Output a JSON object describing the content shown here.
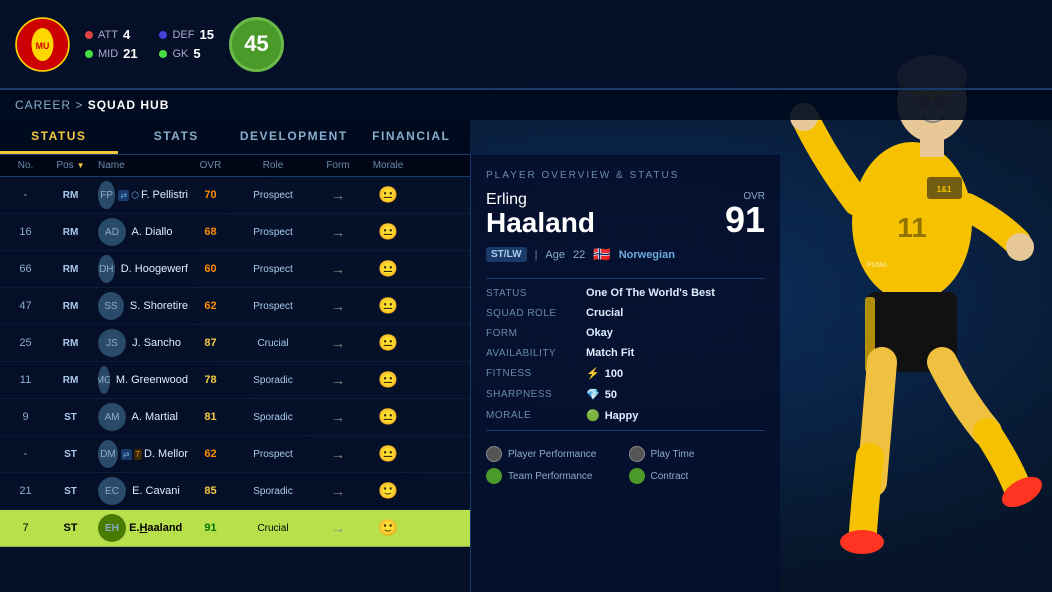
{
  "club": {
    "name": "Manchester United",
    "stats": {
      "att": {
        "label": "ATT",
        "value": "4",
        "color": "#dd4444"
      },
      "def": {
        "label": "DEF",
        "value": "15",
        "color": "#4444dd"
      },
      "mid": {
        "label": "MID",
        "value": "21",
        "color": "#44dd44"
      },
      "gk": {
        "label": "GK",
        "value": "5",
        "color": "#44dd44"
      },
      "overall": "45"
    }
  },
  "breadcrumb": {
    "parent": "CAREER",
    "current": "SQUAD HUB"
  },
  "nav": {
    "tabs": [
      "STATUS",
      "STATS",
      "DEVELOPMENT",
      "FINANCIAL"
    ],
    "active": "STATUS"
  },
  "table": {
    "headers": [
      "No.",
      "Pos ▼",
      "Name",
      "OVR",
      "Role",
      "Form",
      "Morale"
    ],
    "rows": [
      {
        "no": "-",
        "pos": "RM",
        "name": "F. Pellistri",
        "bold_part": "F.",
        "ovr": "70",
        "ovr_class": "ovr-orange",
        "role": "Prospect",
        "form": "→",
        "morale": "😐",
        "morale_class": "morale-neutral",
        "icons": [
          "transfer"
        ],
        "selected": false
      },
      {
        "no": "16",
        "pos": "RM",
        "name": "A. Diallo",
        "bold_part": "A.",
        "ovr": "68",
        "ovr_class": "ovr-orange",
        "role": "Prospect",
        "form": "→",
        "morale": "😐",
        "morale_class": "morale-neutral",
        "icons": [],
        "selected": false
      },
      {
        "no": "66",
        "pos": "RM",
        "name": "D. Hoogewerf",
        "bold_part": "D.",
        "ovr": "60",
        "ovr_class": "ovr-orange",
        "role": "Prospect",
        "form": "→",
        "morale": "😐",
        "morale_class": "morale-neutral",
        "icons": [],
        "selected": false
      },
      {
        "no": "47",
        "pos": "RM",
        "name": "S. Shoretire",
        "bold_part": "S.",
        "ovr": "62",
        "ovr_class": "ovr-orange",
        "role": "Prospect",
        "form": "→",
        "morale": "😐",
        "morale_class": "morale-neutral",
        "icons": [],
        "selected": false
      },
      {
        "no": "25",
        "pos": "RM",
        "name": "J. Sancho",
        "bold_part": "J.",
        "ovr": "87",
        "ovr_class": "ovr-yellow",
        "role": "Crucial",
        "form": "→",
        "morale": "😐",
        "morale_class": "morale-neutral",
        "icons": [],
        "selected": false
      },
      {
        "no": "11",
        "pos": "RM",
        "name": "M. Greenwood",
        "bold_part": "M.",
        "ovr": "78",
        "ovr_class": "ovr-yellow",
        "role": "Sporadic",
        "form": "→",
        "morale": "😐",
        "morale_class": "morale-neutral",
        "icons": [],
        "selected": false
      },
      {
        "no": "9",
        "pos": "ST",
        "name": "A. Martial",
        "bold_part": "A.",
        "ovr": "81",
        "ovr_class": "ovr-yellow",
        "role": "Sporadic",
        "form": "→",
        "morale": "😐",
        "morale_class": "morale-neutral",
        "icons": [],
        "selected": false
      },
      {
        "no": "-",
        "pos": "ST",
        "name": "D. Mellor",
        "bold_part": "D.",
        "ovr": "62",
        "ovr_class": "ovr-orange",
        "role": "Prospect",
        "form": "→",
        "morale": "😐",
        "morale_class": "morale-neutral",
        "icons": [
          "transfer",
          "loan"
        ],
        "selected": false
      },
      {
        "no": "21",
        "pos": "ST",
        "name": "E. Cavani",
        "bold_part": "E.",
        "ovr": "85",
        "ovr_class": "ovr-yellow",
        "role": "Sporadic",
        "form": "→",
        "morale": "🙂",
        "morale_class": "morale-happy",
        "icons": [],
        "selected": false
      },
      {
        "no": "7",
        "pos": "ST",
        "name": "E.Haaland",
        "bold_part": "E.",
        "highlight_char": "H",
        "ovr": "91",
        "ovr_class": "ovr-green",
        "role": "Crucial",
        "form": "→",
        "morale": "🙂",
        "morale_class": "morale-happy",
        "icons": [],
        "selected": true
      }
    ]
  },
  "player_panel": {
    "title": "PLAYER OVERVIEW & STATUS",
    "first_name": "Erling",
    "last_name": "Haaland",
    "ovr_label": "OVR",
    "ovr_value": "91",
    "position": "ST/LW",
    "age_label": "Age",
    "age": "22",
    "nationality": "Norwegian",
    "flag": "🇳🇴",
    "stats": [
      {
        "key": "STATUS",
        "value": "One Of The World's Best"
      },
      {
        "key": "SQUAD ROLE",
        "value": "Crucial"
      },
      {
        "key": "FORM",
        "value": "Okay"
      },
      {
        "key": "AVAILABILITY",
        "value": "Match Fit"
      },
      {
        "key": "FITNESS",
        "value": "100",
        "icon": "⚡"
      },
      {
        "key": "SHARPNESS",
        "value": "50",
        "icon": "💎"
      },
      {
        "key": "MORALE",
        "value": "Happy",
        "icon": "🟢"
      }
    ],
    "legend": [
      {
        "label": "Player Performance",
        "type": "grey"
      },
      {
        "label": "Play Time",
        "type": "grey"
      },
      {
        "label": "Team Performance",
        "type": "green"
      },
      {
        "label": "Contract",
        "type": "green"
      }
    ]
  }
}
